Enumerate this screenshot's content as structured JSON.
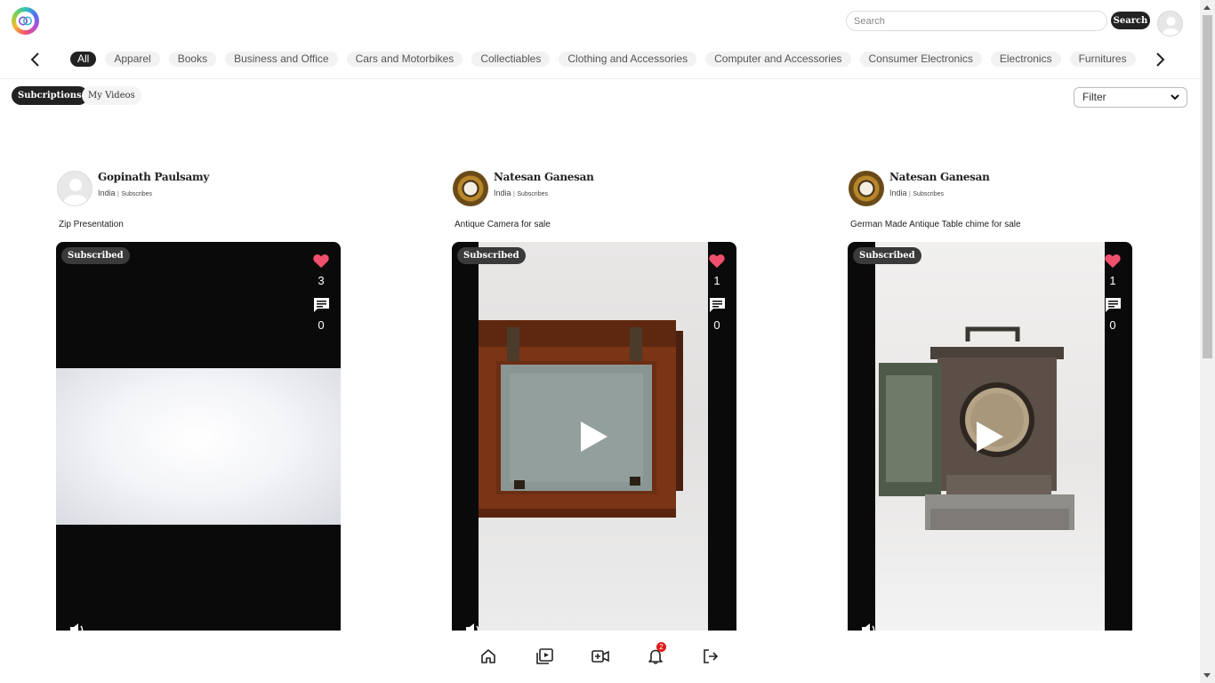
{
  "header": {
    "search_placeholder": "Search",
    "search_button": "Search"
  },
  "categories": [
    "All",
    "Apparel",
    "Books",
    "Business and Office",
    "Cars and Motorbikes",
    "Collectiables",
    "Clothing and Accessories",
    "Computer and Accessories",
    "Consumer Electronics",
    "Electronics",
    "Furnitures"
  ],
  "active_category": "All",
  "tabs": {
    "subscriptions": "Subcriptions",
    "my_videos": "My Videos"
  },
  "filter": {
    "selected": "Filter"
  },
  "posts": [
    {
      "author": "Gopinath Paulsamy",
      "country": "India",
      "separator": "|",
      "subscribes_label": "Subscribes",
      "title": "Zip Presentation",
      "badge": "Subscribed",
      "likes": "3",
      "comments": "0",
      "avatar": "default-avatar"
    },
    {
      "author": "Natesan Ganesan",
      "country": "India",
      "separator": "|",
      "subscribes_label": "Subscribes",
      "title": "Antique Camera for sale",
      "badge": "Subscribed",
      "likes": "1",
      "comments": "0",
      "avatar": "antique-clock-avatar"
    },
    {
      "author": "Natesan Ganesan",
      "country": "India",
      "separator": "|",
      "subscribes_label": "Subscribes",
      "title": "German Made Antique Table chime for sale",
      "badge": "Subscribed",
      "likes": "1",
      "comments": "0",
      "avatar": "antique-clock-avatar"
    }
  ],
  "bottom_nav": {
    "items": [
      "home-icon",
      "videos-icon",
      "add-video-icon",
      "notifications-icon",
      "logout-icon"
    ],
    "notification_count": "2"
  },
  "colors": {
    "accent_dark": "#222222",
    "heart": "#f0506e",
    "notification": "#e01b1b"
  }
}
